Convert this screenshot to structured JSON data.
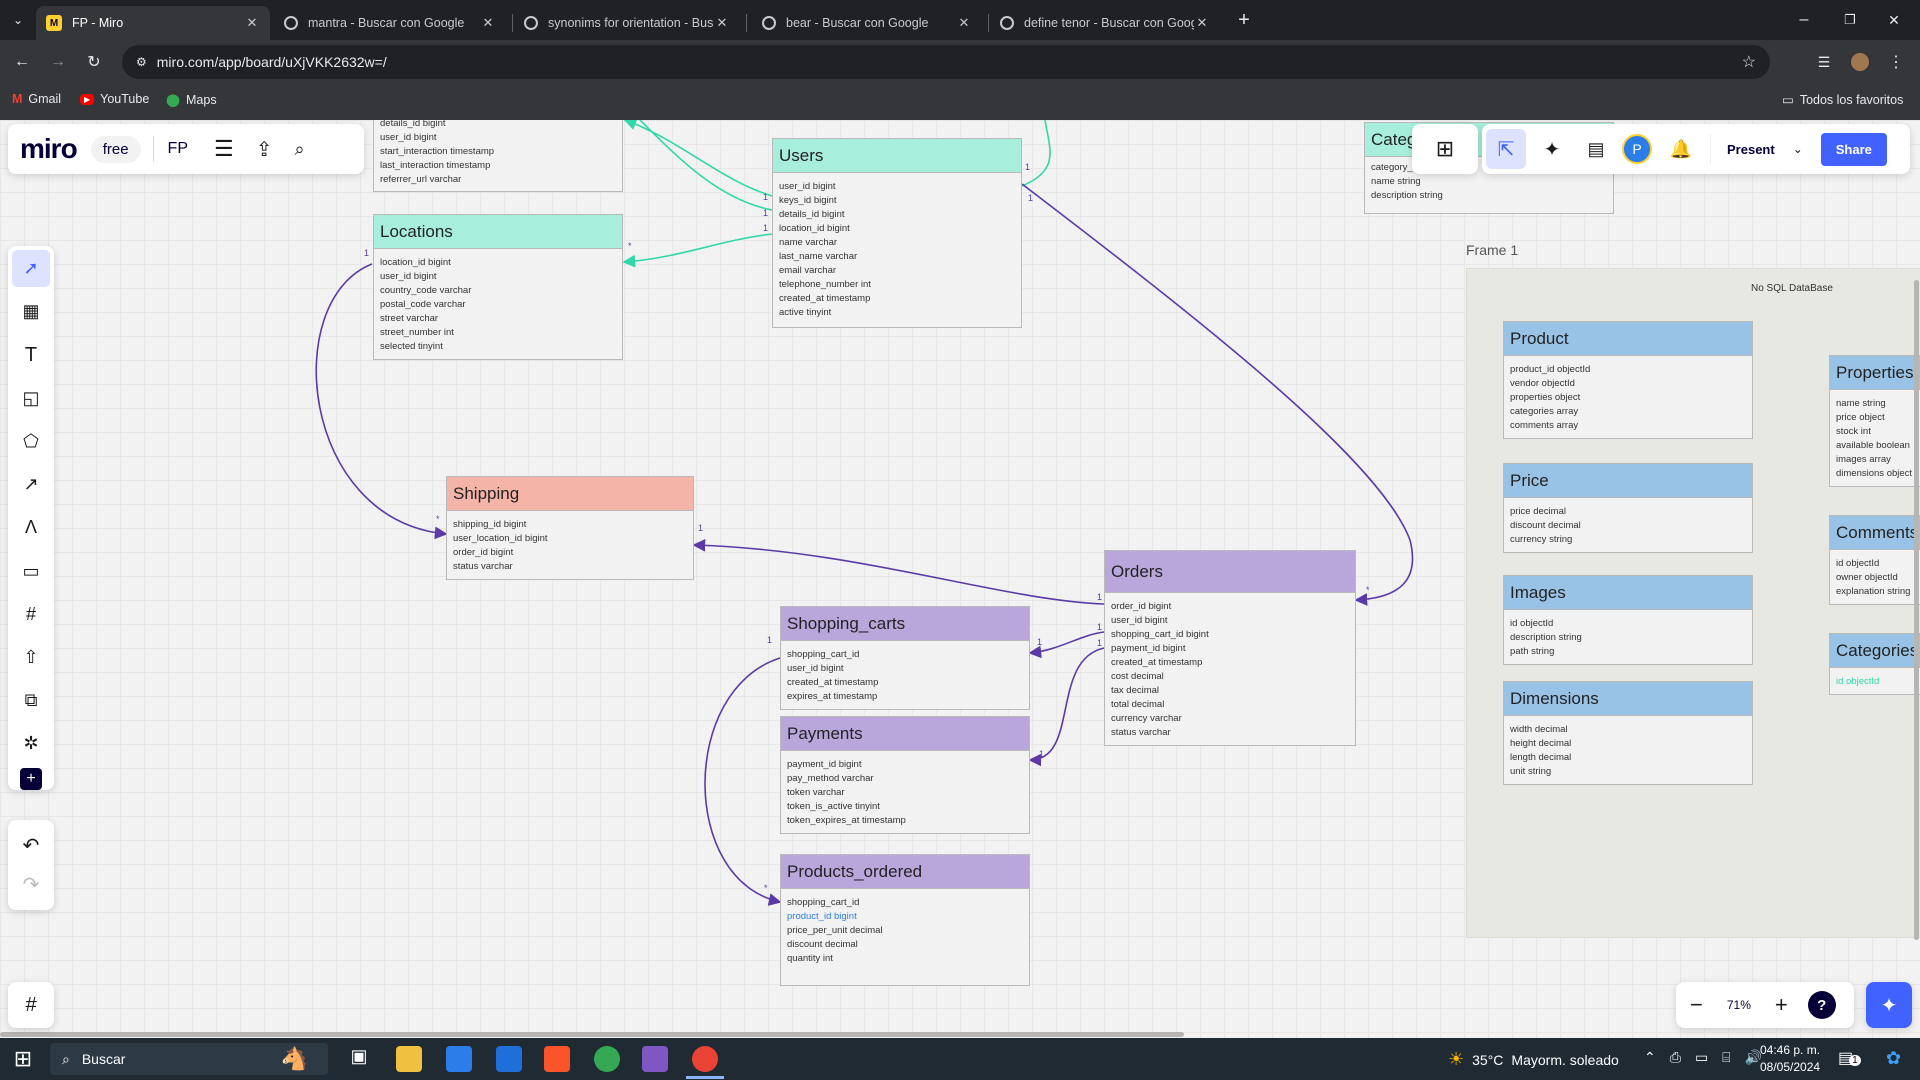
{
  "browser": {
    "tabs": [
      {
        "title": "FP - Miro",
        "active": true
      },
      {
        "title": "mantra - Buscar con Google"
      },
      {
        "title": "synonims for orientation - Busc"
      },
      {
        "title": "bear - Buscar con Google"
      },
      {
        "title": "define tenor - Buscar con Goog"
      }
    ],
    "url": "miro.com/app/board/uXjVKK2632w=/",
    "bookmarks": [
      "Gmail",
      "YouTube",
      "Maps"
    ],
    "bookmarks_right": "Todos los favoritos"
  },
  "miro": {
    "logo": "miro",
    "plan_badge": "free",
    "board_name": "FP",
    "present_label": "Present",
    "share_label": "Share",
    "avatar_letter": "P",
    "zoom": "71%",
    "frame_title": "Frame 1",
    "nosql_label": "No SQL  DataBase"
  },
  "tables": {
    "top_partial": {
      "fields": [
        "details_id bigint",
        "user_id bigint",
        "start_interaction timestamp",
        "last_interaction timestamp",
        "referrer_url  varchar"
      ]
    },
    "users": {
      "title": "Users",
      "fields": [
        "user_id bigint",
        "keys_id bigint",
        "details_id bigint",
        "location_id bigint",
        "name varchar",
        "last_name varchar",
        "email varchar",
        "telephone_number int",
        "created_at timestamp",
        "active tinyint"
      ]
    },
    "categories_top": {
      "title": "Catego",
      "fields": [
        "category_id",
        "name string",
        "description string"
      ]
    },
    "locations": {
      "title": "Locations",
      "fields": [
        "location_id bigint",
        "user_id bigint",
        "country_code varchar",
        "postal_code varchar",
        "street varchar",
        "street_number int",
        "selected tinyint"
      ]
    },
    "shipping": {
      "title": "Shipping",
      "fields": [
        "shipping_id bigint",
        "user_location_id bigint",
        "order_id bigint",
        "status varchar"
      ]
    },
    "orders": {
      "title": "Orders",
      "fields": [
        "order_id bigint",
        "user_id bigint",
        "shopping_cart_id bigint",
        "payment_id bigint",
        "created_at timestamp",
        "cost decimal",
        "tax decimal",
        "total decimal",
        "currency varchar",
        "status varchar"
      ]
    },
    "shopping_carts": {
      "title": "Shopping_carts",
      "fields": [
        "shopping_cart_id",
        "user_id bigint",
        "created_at timestamp",
        "expires_at timestamp"
      ]
    },
    "payments": {
      "title": "Payments",
      "fields": [
        "payment_id bigint",
        "pay_method varchar",
        "token varchar",
        "token_is_active tinyint",
        "token_expires_at timestamp"
      ]
    },
    "products_ordered": {
      "title": "Products_ordered",
      "fields": [
        "shopping_cart_id",
        "product_id bigint",
        "price_per_unit decimal",
        "discount decimal",
        "quantity int"
      ]
    },
    "product": {
      "title": "Product",
      "fields": [
        "product_id objectId",
        "vendor objectId",
        "properties object",
        "categories  array",
        "comments array"
      ]
    },
    "price": {
      "title": "Price",
      "fields": [
        "price decimal",
        "discount decimal",
        "currency string"
      ]
    },
    "images": {
      "title": "Images",
      "fields": [
        "id objectId",
        "description string",
        "path string"
      ]
    },
    "dimensions": {
      "title": "Dimensions",
      "fields": [
        "width decimal",
        "height decimal",
        "length decimal",
        "unit string"
      ]
    },
    "properties": {
      "title": "Properties",
      "fields": [
        "name string",
        "price object",
        "stock int",
        "available boolean",
        "images array",
        "dimensions object"
      ]
    },
    "comments": {
      "title": "Comments",
      "fields": [
        "id objectId",
        "owner objectId",
        "explanation string"
      ]
    },
    "categories": {
      "title": "Categories",
      "fields": [
        "id objectId"
      ]
    }
  },
  "relation_labels": {
    "one": "1",
    "many": "*"
  },
  "taskbar": {
    "search_placeholder": "Buscar",
    "weather_temp": "35°C",
    "weather_desc": "Mayorm. soleado",
    "time": "04:46 p. m.",
    "date": "08/05/2024",
    "notif_count": "1"
  }
}
